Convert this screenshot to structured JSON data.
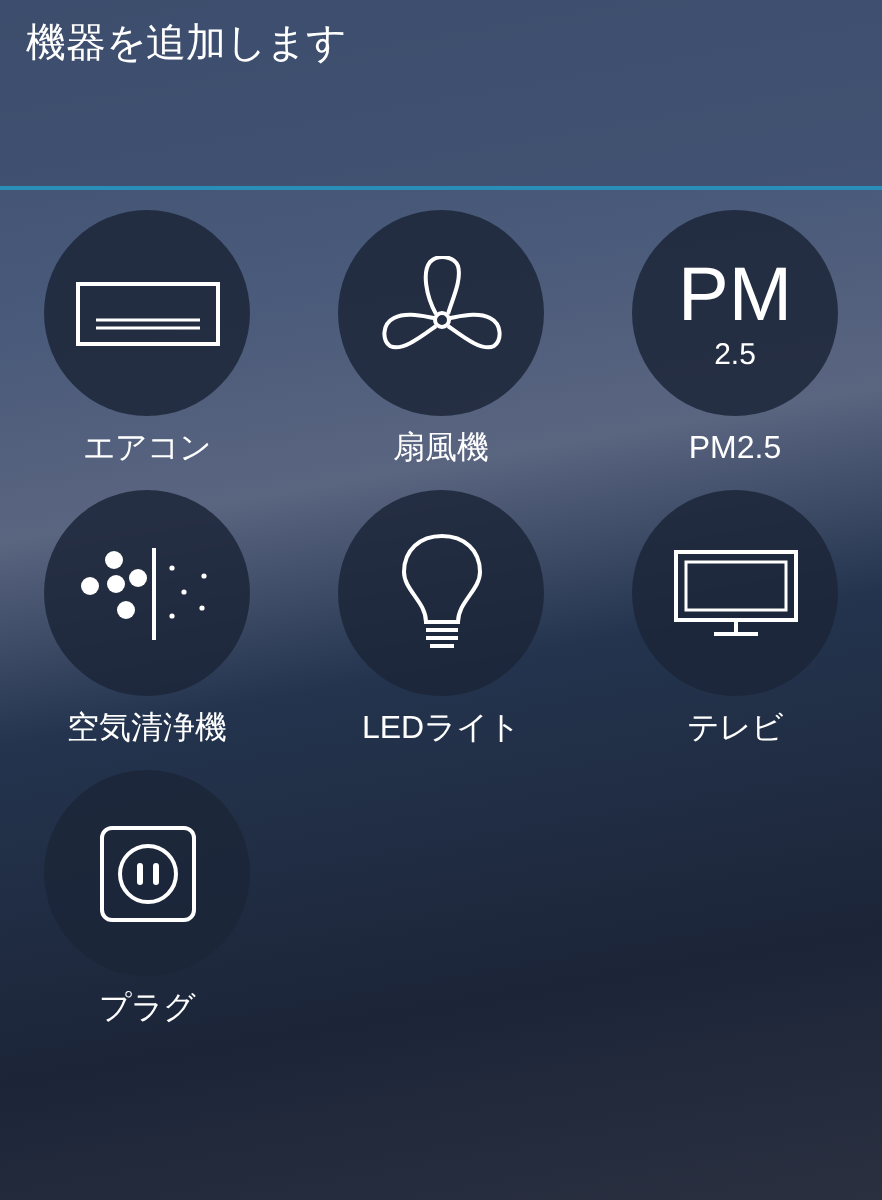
{
  "header": {
    "title": "機器を追加します"
  },
  "devices": [
    {
      "kind": "aircon",
      "label": "エアコン"
    },
    {
      "kind": "fan",
      "label": "扇風機"
    },
    {
      "kind": "pm",
      "label": "PM2.5",
      "icon_text": "PM",
      "icon_subtext": "2.5"
    },
    {
      "kind": "purifier",
      "label": "空気清浄機"
    },
    {
      "kind": "bulb",
      "label": "LEDライト"
    },
    {
      "kind": "tv",
      "label": "テレビ"
    },
    {
      "kind": "plug",
      "label": "プラグ"
    }
  ]
}
